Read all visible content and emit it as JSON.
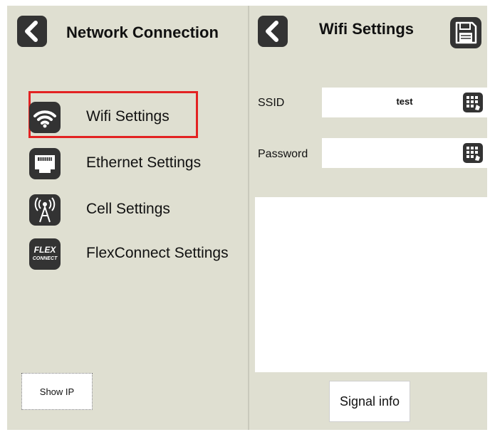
{
  "left_panel": {
    "title": "Network Connection",
    "items": [
      {
        "label": "Wifi Settings",
        "icon": "wifi-icon",
        "selected": true
      },
      {
        "label": "Ethernet Settings",
        "icon": "ethernet-icon",
        "selected": false
      },
      {
        "label": "Cell Settings",
        "icon": "cell-tower-icon",
        "selected": false
      },
      {
        "label": "FlexConnect Settings",
        "icon": "flexconnect-icon",
        "selected": false
      }
    ],
    "flex_logo_text": [
      "FLEX",
      "CONNECT"
    ],
    "show_ip_label": "Show IP"
  },
  "right_panel": {
    "title": "Wifi Settings",
    "ssid_label": "SSID",
    "ssid_value": "test",
    "password_label": "Password",
    "password_value": "",
    "signal_info_label": "Signal info"
  },
  "colors": {
    "panel_bg": "#dfdfd1",
    "icon_bg": "#333333",
    "highlight": "#e32222"
  }
}
